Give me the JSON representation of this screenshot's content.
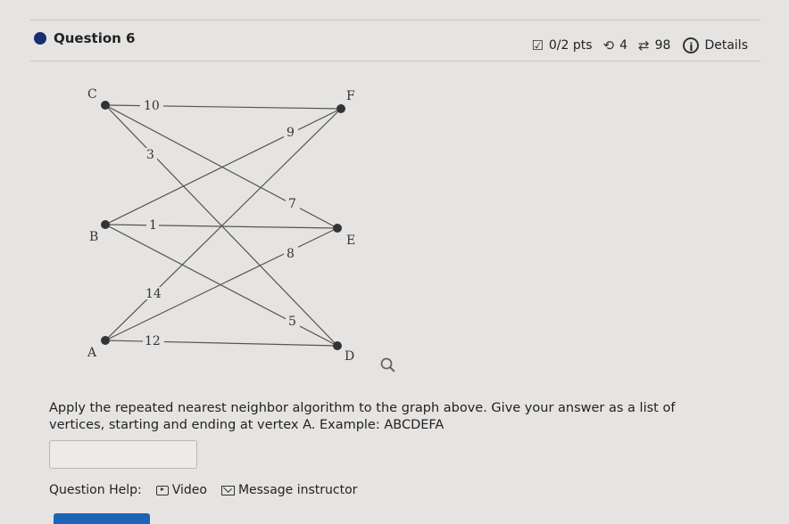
{
  "header": {
    "question_label": "Question 6",
    "points": "0/2 pts",
    "attempts": "4",
    "submissions": "98",
    "details_label": "Details"
  },
  "graph": {
    "vertices": [
      {
        "id": "C",
        "label": "C"
      },
      {
        "id": "F",
        "label": "F"
      },
      {
        "id": "B",
        "label": "B"
      },
      {
        "id": "E",
        "label": "E"
      },
      {
        "id": "A",
        "label": "A"
      },
      {
        "id": "D",
        "label": "D"
      }
    ],
    "edges": [
      {
        "from": "C",
        "to": "F",
        "weight": "10"
      },
      {
        "from": "B",
        "to": "F",
        "weight": "9"
      },
      {
        "from": "C",
        "to": "D",
        "weight": "3"
      },
      {
        "from": "C",
        "to": "E",
        "weight": "7"
      },
      {
        "from": "B",
        "to": "E",
        "weight": "1"
      },
      {
        "from": "A",
        "to": "E",
        "weight": "8"
      },
      {
        "from": "A",
        "to": "F",
        "weight": "14"
      },
      {
        "from": "B",
        "to": "D",
        "weight": "5"
      },
      {
        "from": "A",
        "to": "D",
        "weight": "12"
      }
    ]
  },
  "question": {
    "prompt": "Apply the repeated nearest neighbor algorithm to the graph above. Give your answer as a list of vertices, starting and ending at vertex A. Example: ABCDEFA",
    "answer_value": ""
  },
  "help": {
    "label": "Question Help:",
    "video_label": "Video",
    "message_label": "Message instructor"
  }
}
